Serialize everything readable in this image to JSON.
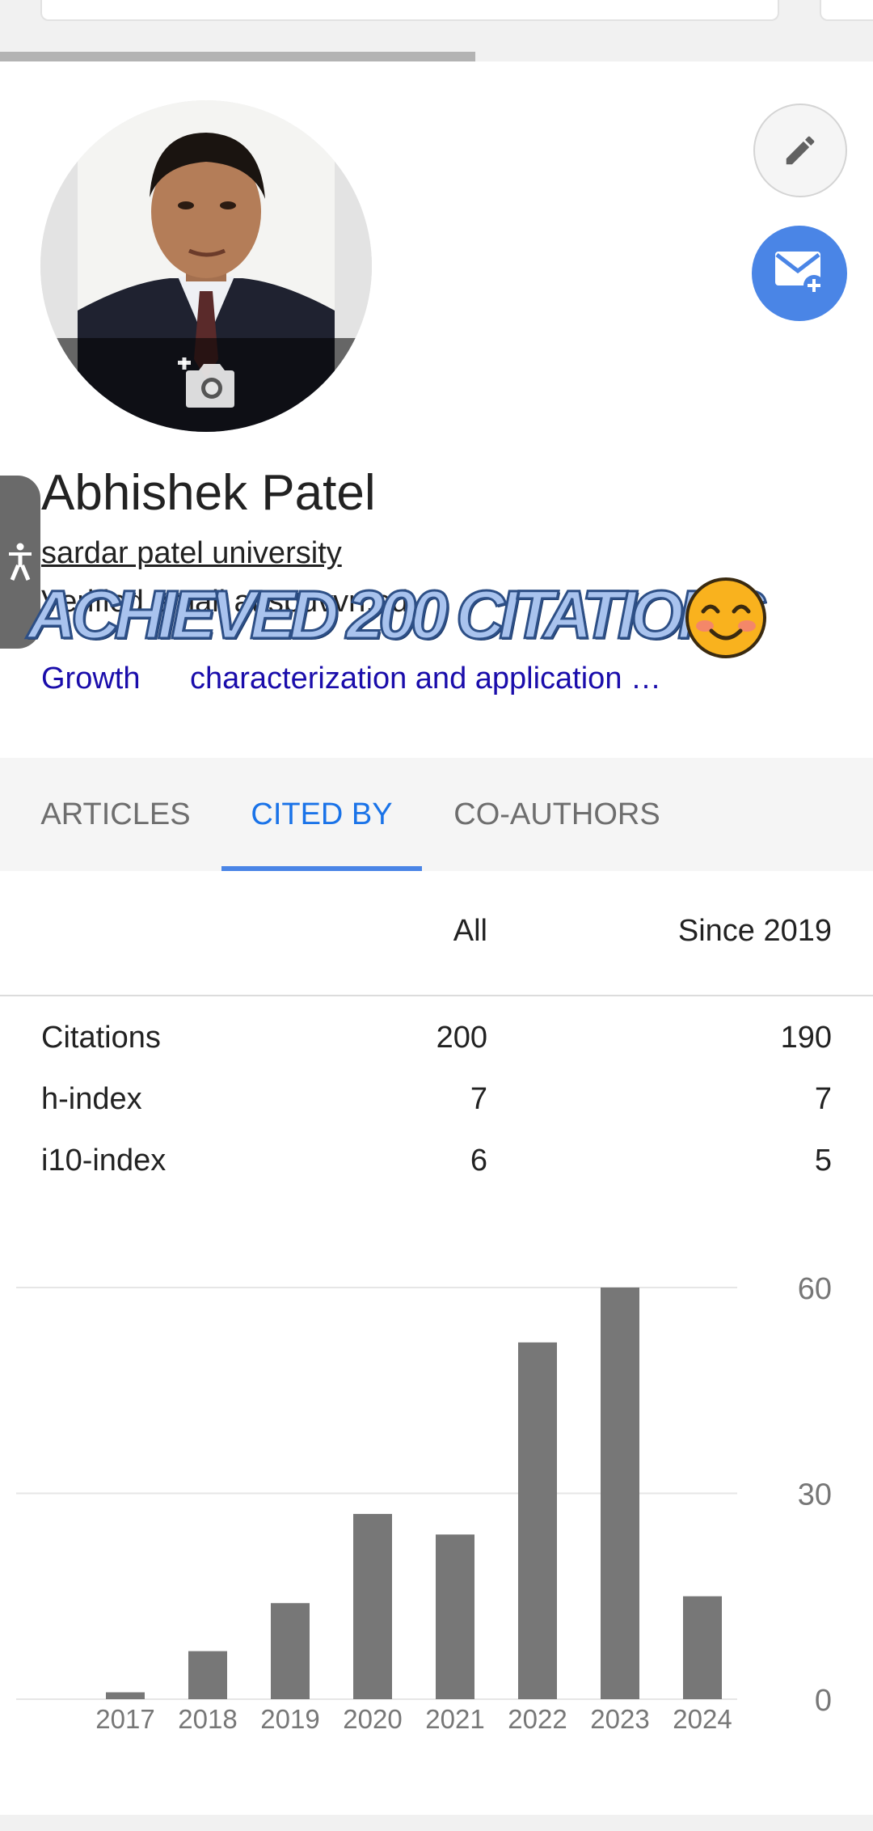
{
  "profile": {
    "name": "Abhishek Patel",
    "affiliation": "sardar patel university",
    "verified": "Verified email at spuvvn.edu",
    "overlay_text": "ACHIEVED 200 CITATIONS",
    "interests": [
      "Growth",
      "characterization and application …"
    ]
  },
  "icons": {
    "edit": "pencil-icon",
    "email": "mail-plus-icon",
    "camera": "add-photo-icon",
    "accessibility": "accessibility-icon",
    "emoji": "smiling-face-emoji"
  },
  "colors": {
    "accent": "#4a85e6",
    "tab_active": "#1a73e8",
    "link": "#1a0dab",
    "bar": "#777777"
  },
  "tabs": [
    {
      "label": "ARTICLES",
      "active": false
    },
    {
      "label": "CITED BY",
      "active": true
    },
    {
      "label": "CO-AUTHORS",
      "active": false
    }
  ],
  "stats": {
    "columns": [
      "All",
      "Since 2019"
    ],
    "rows": [
      {
        "label": "Citations",
        "all": "200",
        "since": "190"
      },
      {
        "label": "h-index",
        "all": "7",
        "since": "7"
      },
      {
        "label": "i10-index",
        "all": "6",
        "since": "5"
      }
    ]
  },
  "chart_data": {
    "type": "bar",
    "categories": [
      "2017",
      "2018",
      "2019",
      "2020",
      "2021",
      "2022",
      "2023",
      "2024"
    ],
    "values": [
      1,
      7,
      14,
      27,
      24,
      52,
      60,
      15
    ],
    "ylim": [
      0,
      60
    ],
    "yticks": [
      0,
      30,
      60
    ],
    "grid": true
  }
}
